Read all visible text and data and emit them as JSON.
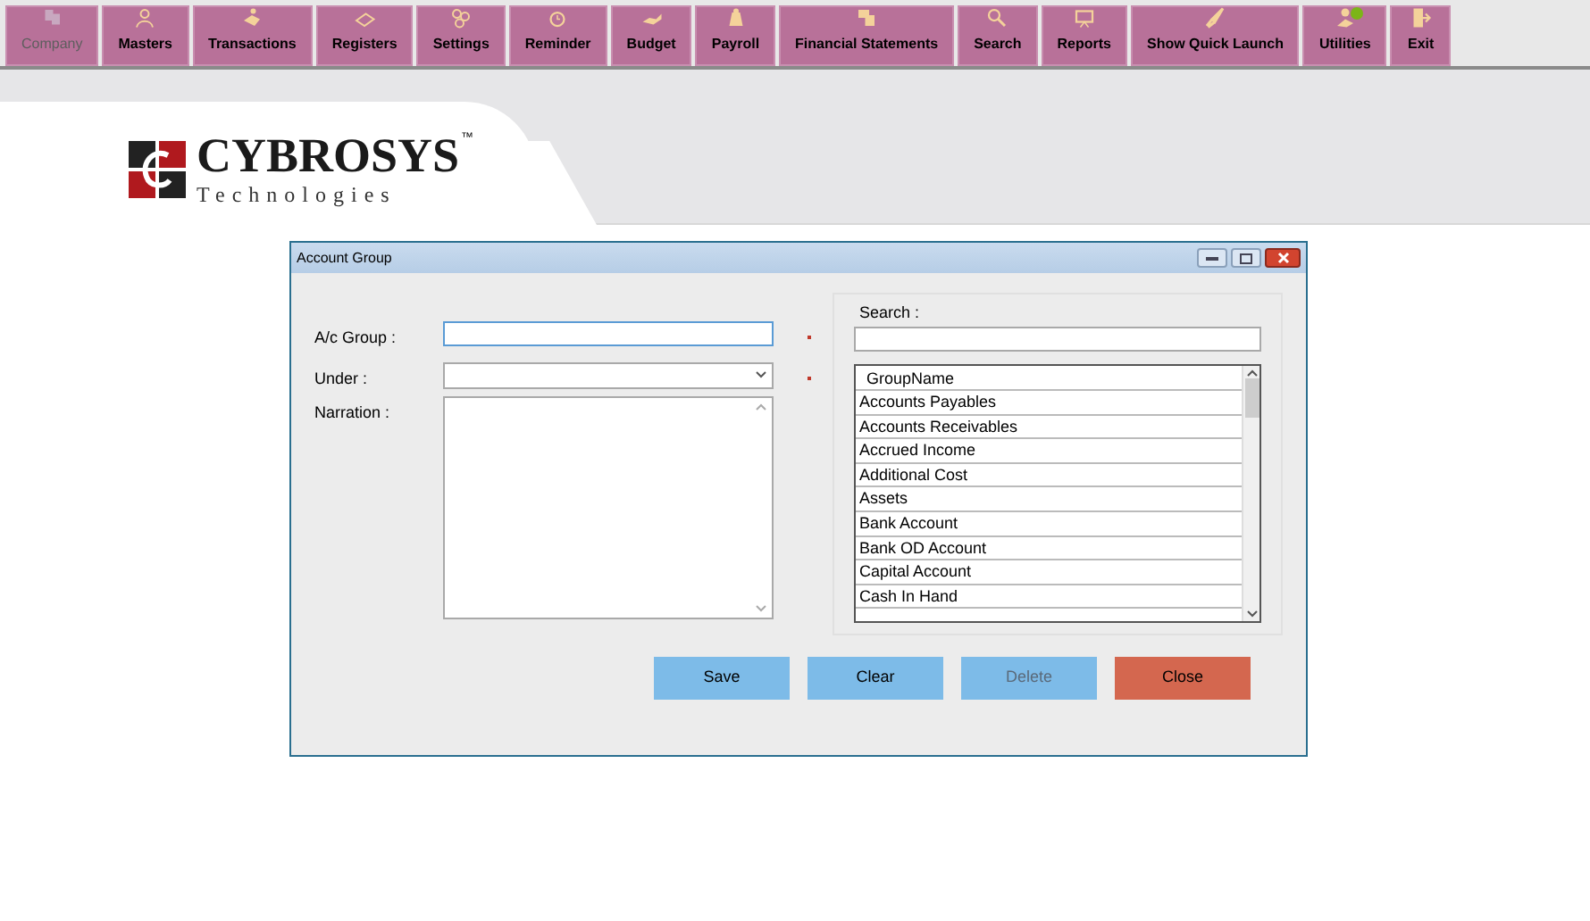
{
  "toolbar": [
    {
      "label": "Company",
      "disabled": true
    },
    {
      "label": "Masters",
      "disabled": false
    },
    {
      "label": "Transactions",
      "disabled": false
    },
    {
      "label": "Registers",
      "disabled": false
    },
    {
      "label": "Settings",
      "disabled": false
    },
    {
      "label": "Reminder",
      "disabled": false
    },
    {
      "label": "Budget",
      "disabled": false
    },
    {
      "label": "Payroll",
      "disabled": false
    },
    {
      "label": "Financial Statements",
      "disabled": false
    },
    {
      "label": "Search",
      "disabled": false
    },
    {
      "label": "Reports",
      "disabled": false
    },
    {
      "label": "Show Quick Launch",
      "disabled": false
    },
    {
      "label": "Utilities",
      "disabled": false
    },
    {
      "label": "Exit",
      "disabled": false
    }
  ],
  "logo": {
    "name": "CYBROSYS",
    "tm": "™",
    "tagline": "Technologies"
  },
  "dialog": {
    "title": "Account Group",
    "fields": [
      {
        "kind": "text",
        "label": "A/c Group :",
        "required": true
      },
      {
        "kind": "select",
        "label": "Under :",
        "required": true
      },
      {
        "kind": "textarea",
        "label": "Narration :",
        "required": false
      }
    ],
    "search": {
      "label": "Search :"
    },
    "table": {
      "columns": [
        "GroupName"
      ],
      "rows": [
        "Accounts Payables",
        "Accounts Receivables",
        "Accrued Income",
        "Additional Cost",
        "Assets",
        "Bank Account",
        "Bank OD Account",
        "Capital Account",
        "Cash In Hand"
      ]
    },
    "buttons": [
      {
        "label": "Save",
        "kind": "primary",
        "disabled": false
      },
      {
        "label": "Clear",
        "kind": "primary",
        "disabled": false
      },
      {
        "label": "Delete",
        "kind": "primary",
        "disabled": true
      },
      {
        "label": "Close",
        "kind": "danger",
        "disabled": false
      }
    ]
  }
}
